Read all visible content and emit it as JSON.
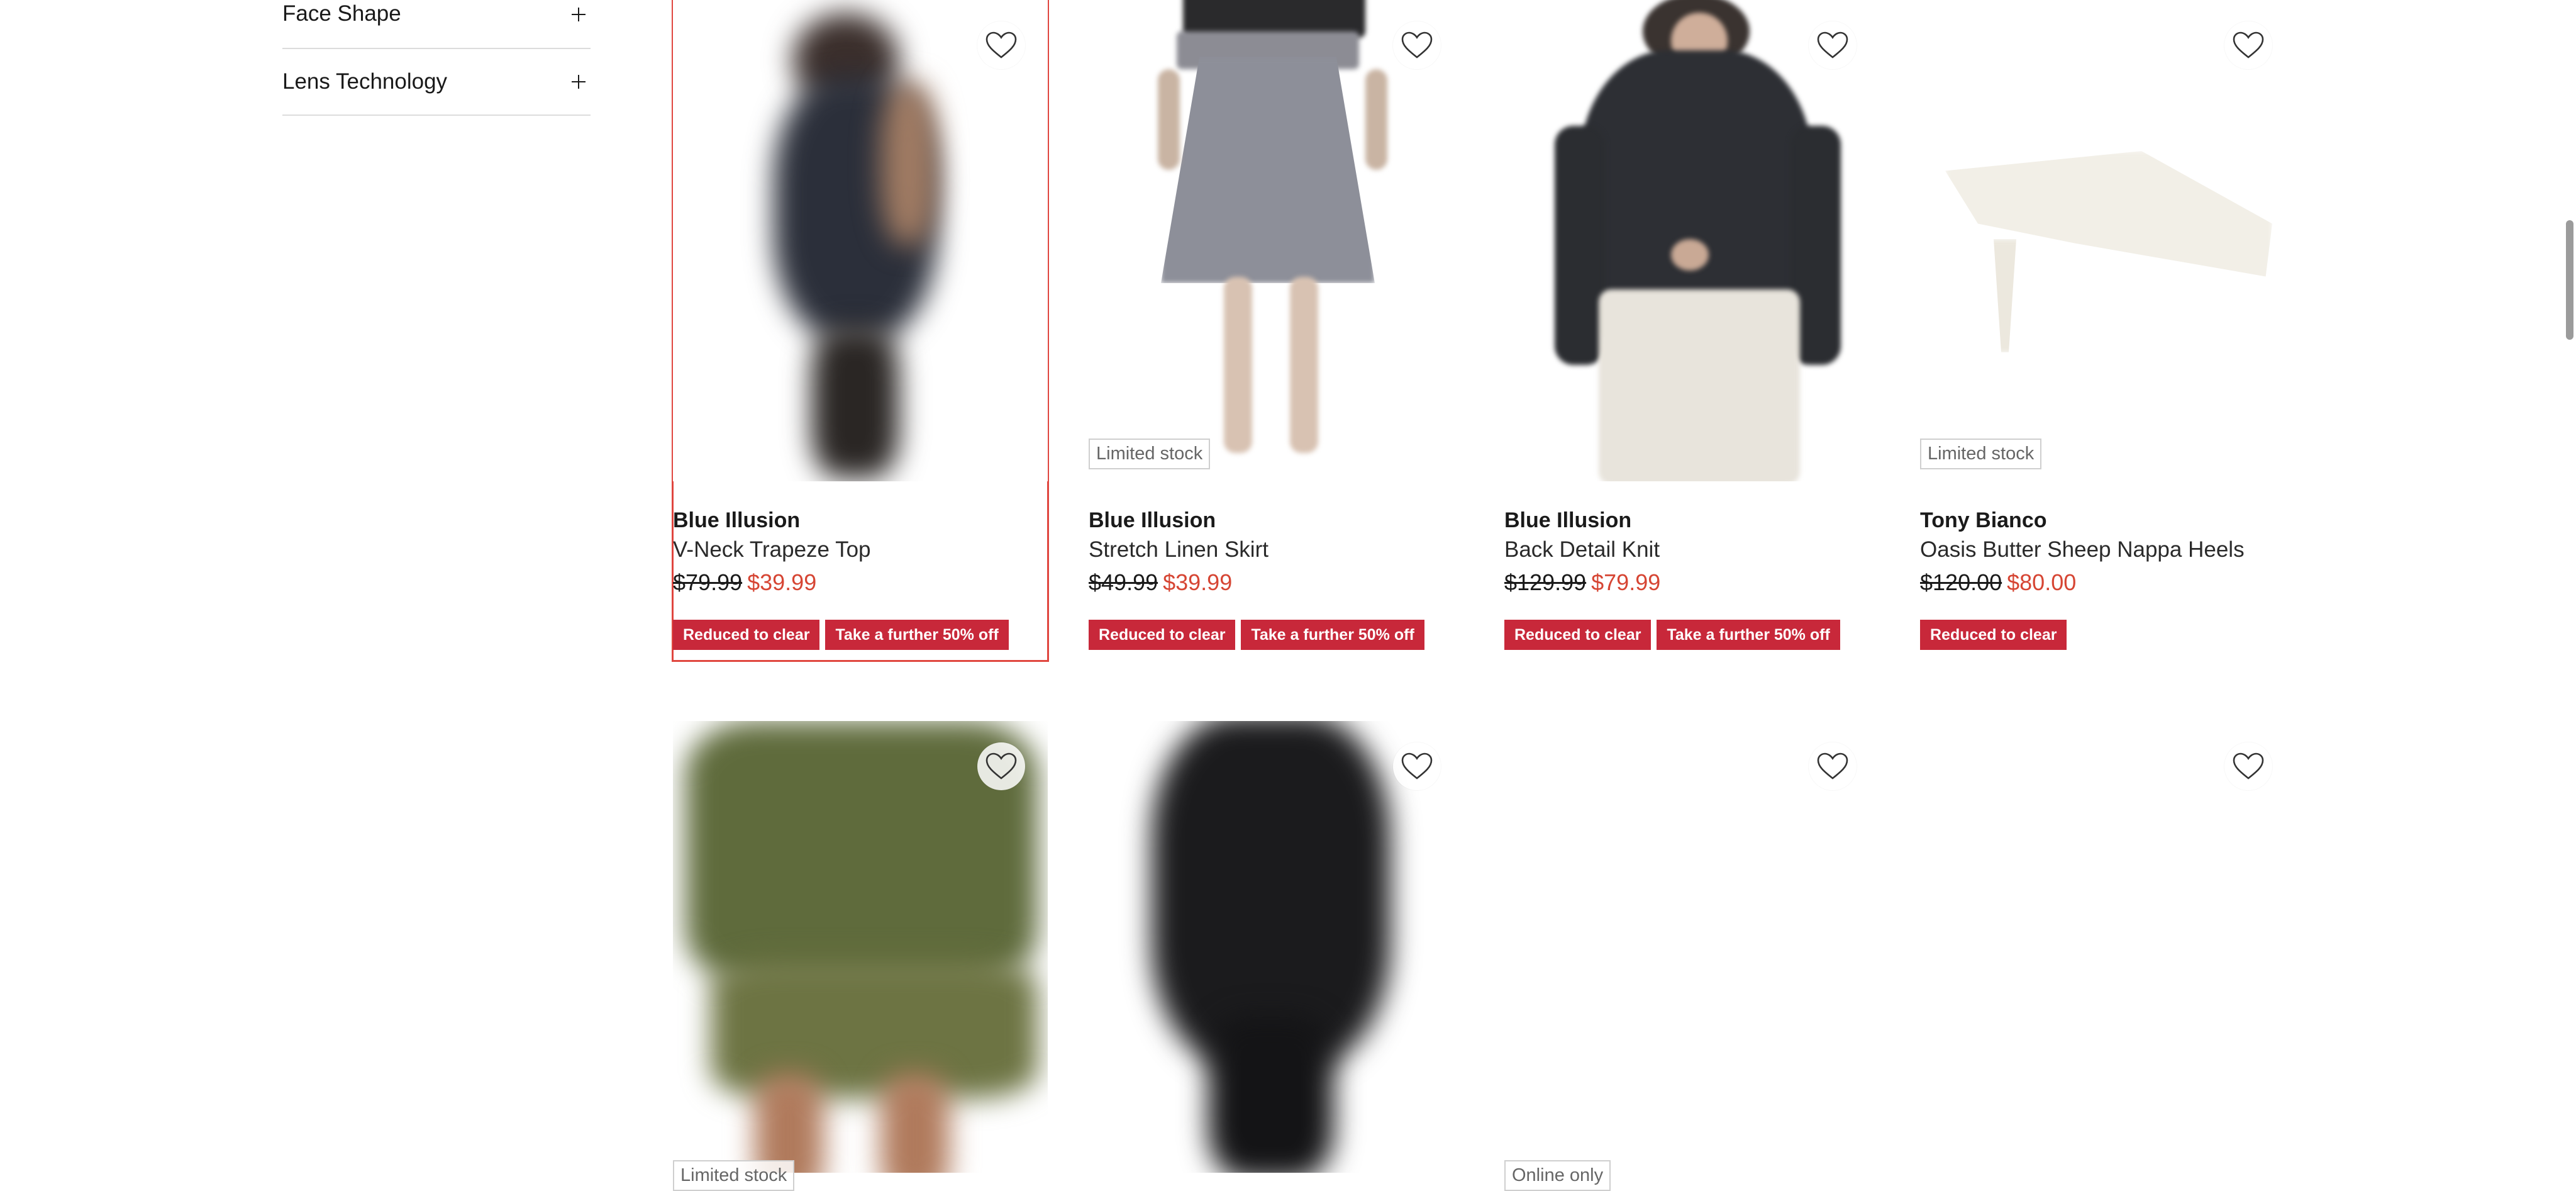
{
  "filters": [
    {
      "label": "Face Shape"
    },
    {
      "label": "Lens Technology"
    }
  ],
  "products_row1": [
    {
      "brand": "Blue Illusion",
      "name": "V-Neck Trapeze Top",
      "was": "$79.99",
      "now": "$39.99",
      "badges": [
        "Reduced to clear",
        "Take a further 50% off"
      ],
      "stock": ""
    },
    {
      "brand": "Blue Illusion",
      "name": "Stretch Linen Skirt",
      "was": "$49.99",
      "now": "$39.99",
      "badges": [
        "Reduced to clear",
        "Take a further 50% off"
      ],
      "stock": "Limited stock"
    },
    {
      "brand": "Blue Illusion",
      "name": "Back Detail Knit",
      "was": "$129.99",
      "now": "$79.99",
      "badges": [
        "Reduced to clear",
        "Take a further 50% off"
      ],
      "stock": ""
    },
    {
      "brand": "Tony Bianco",
      "name": "Oasis Butter Sheep Nappa Heels",
      "was": "$120.00",
      "now": "$80.00",
      "badges": [
        "Reduced to clear"
      ],
      "stock": "Limited stock"
    }
  ],
  "products_row2_tags": [
    "Limited stock",
    "",
    "Online only",
    ""
  ],
  "colors": {
    "accent_price": "#d64533",
    "badge_red": "#c8283a",
    "selected_outline": "#e0463f"
  },
  "icons": {
    "wishlist": "heart-outline-icon",
    "expand": "plus-icon"
  }
}
